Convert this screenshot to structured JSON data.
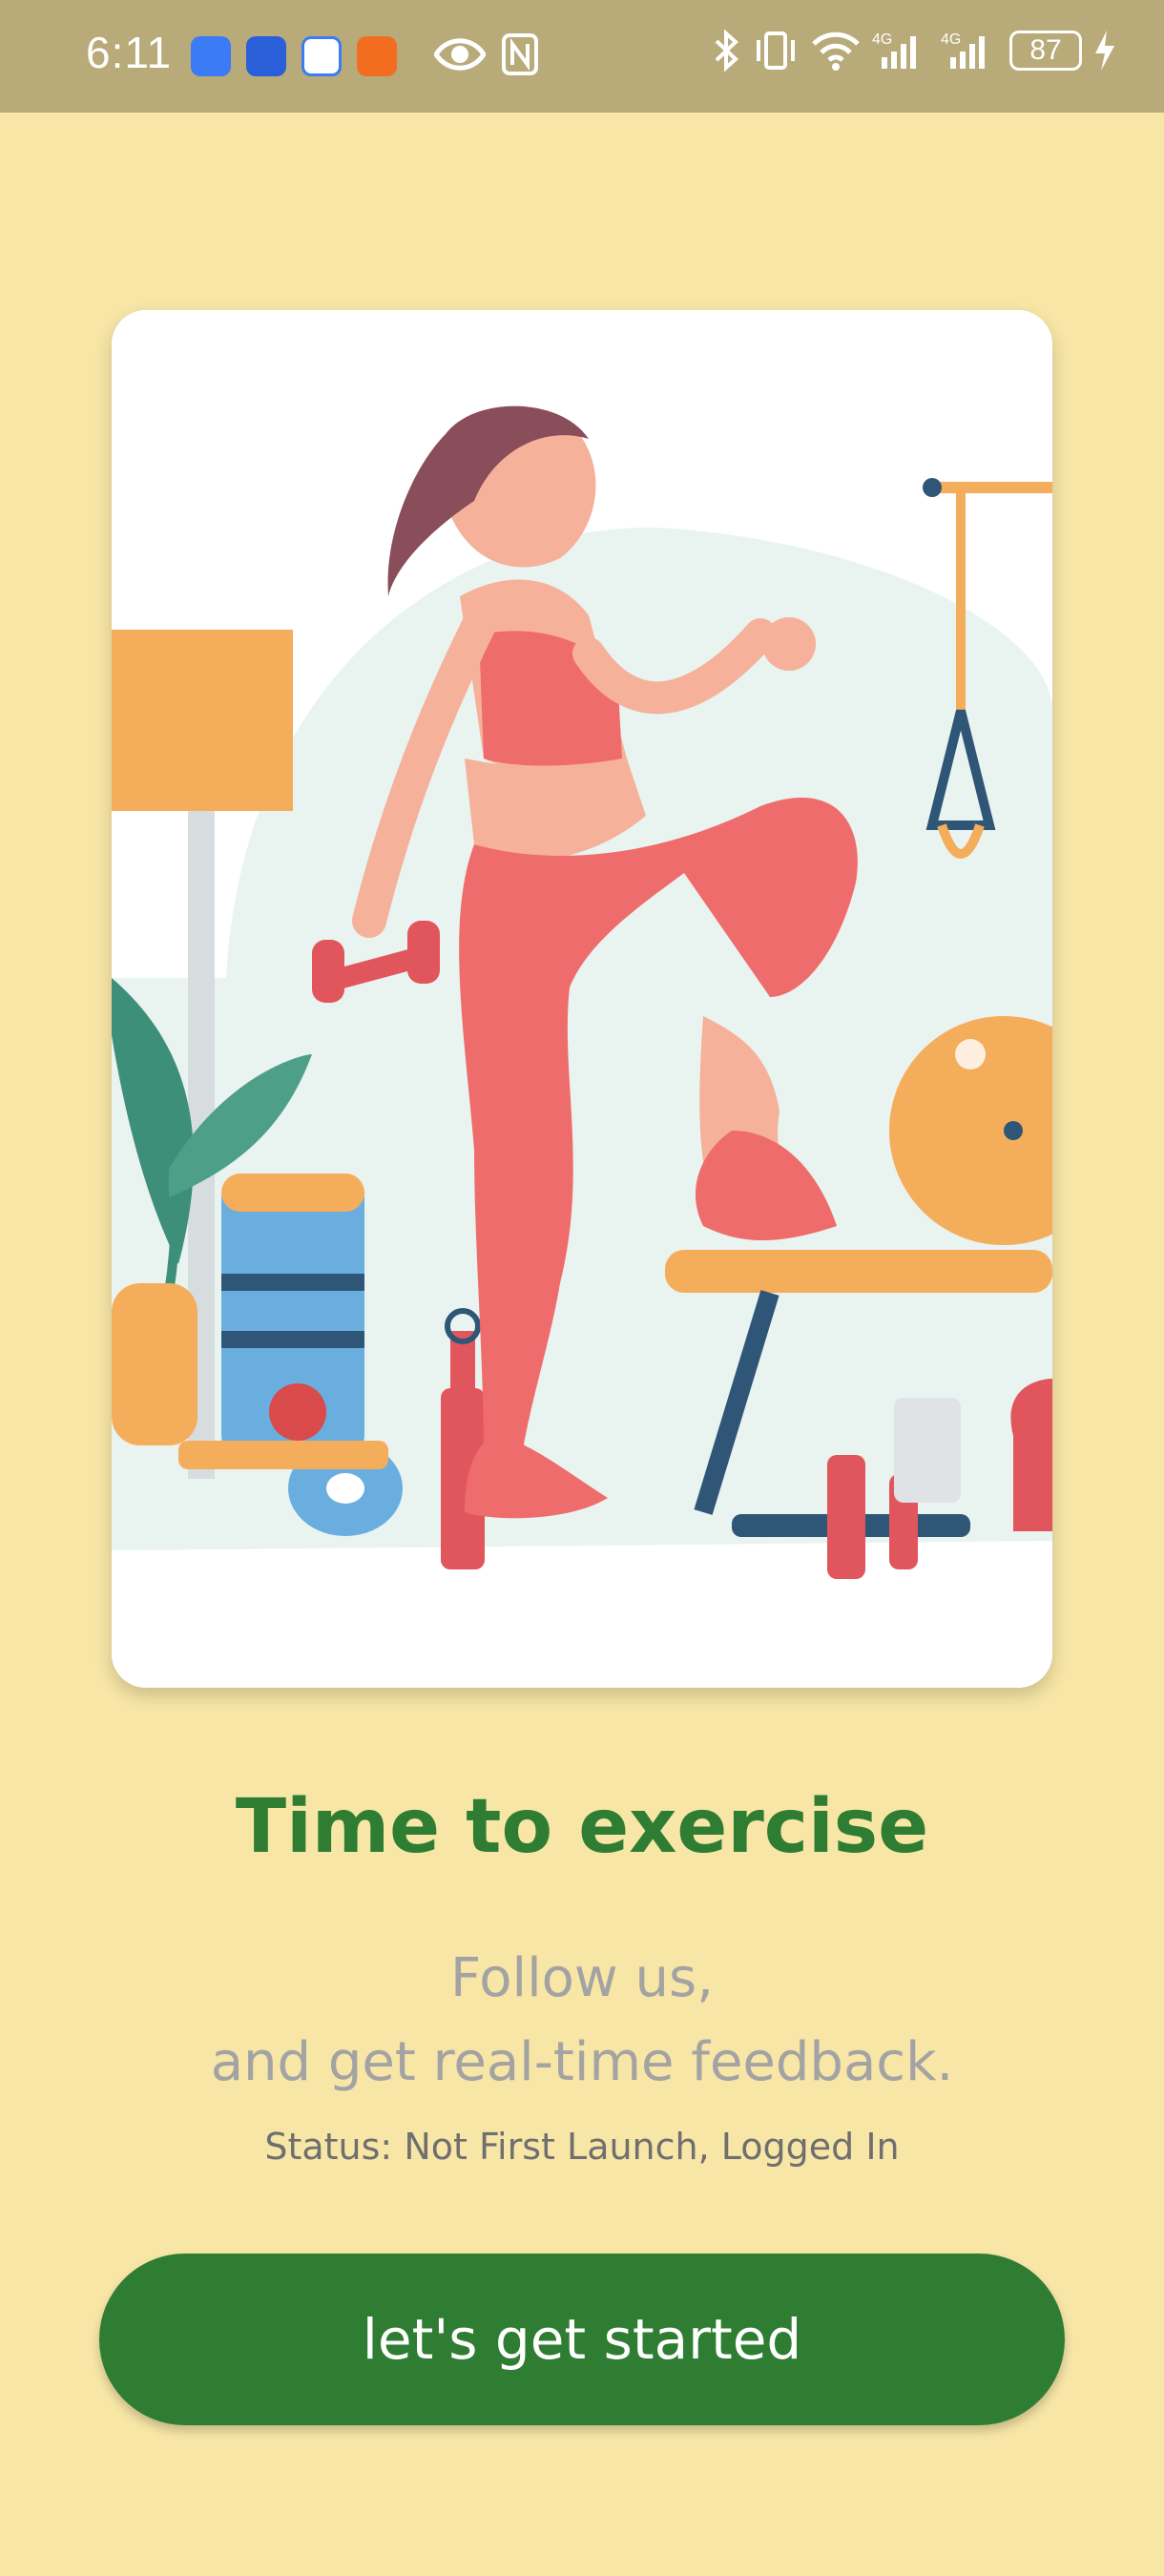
{
  "statusbar": {
    "time": "6:11",
    "battery": "87",
    "icons": [
      "usb-icon",
      "app-icon-blue",
      "app-icon-blue2",
      "app-icon-white",
      "app-icon-orange",
      "eye-icon",
      "nfc-icon",
      "bluetooth-icon",
      "vibrate-icon",
      "wifi-icon",
      "signal-4g-icon",
      "signal-4g-icon-2",
      "charging-icon"
    ]
  },
  "onboarding": {
    "title": "Time to exercise",
    "subtitle_line1": "Follow us,",
    "subtitle_line2": "and get real-time feedback.",
    "status": "Status: Not First Launch, Logged In",
    "cta_label": "let's get started"
  },
  "colors": {
    "background": "#f7e6a6",
    "statusbar": "#b8aa79",
    "accent": "#2e7d32",
    "subtitle": "#a3a3a3"
  }
}
